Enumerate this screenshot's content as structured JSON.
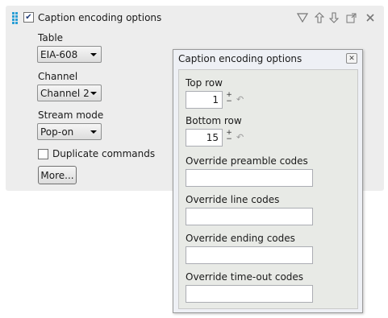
{
  "panel": {
    "title": "Caption encoding options",
    "enabled": true,
    "icons": [
      "filter-icon",
      "move-up-icon",
      "move-down-icon",
      "popout-icon",
      "close-icon"
    ],
    "table_label": "Table",
    "table_value": "EIA-608",
    "channel_label": "Channel",
    "channel_value": "Channel 2",
    "stream_label": "Stream mode",
    "stream_value": "Pop-on",
    "duplicate_label": "Duplicate commands",
    "duplicate_checked": false,
    "more_label": "More..."
  },
  "popup": {
    "title": "Caption encoding options",
    "top_row_label": "Top row",
    "top_row_value": "1",
    "bottom_row_label": "Bottom row",
    "bottom_row_value": "15",
    "preamble_label": "Override preamble codes",
    "preamble_value": "",
    "line_label": "Override line codes",
    "line_value": "",
    "ending_label": "Override ending codes",
    "ending_value": "",
    "timeout_label": "Override time-out codes",
    "timeout_value": ""
  }
}
